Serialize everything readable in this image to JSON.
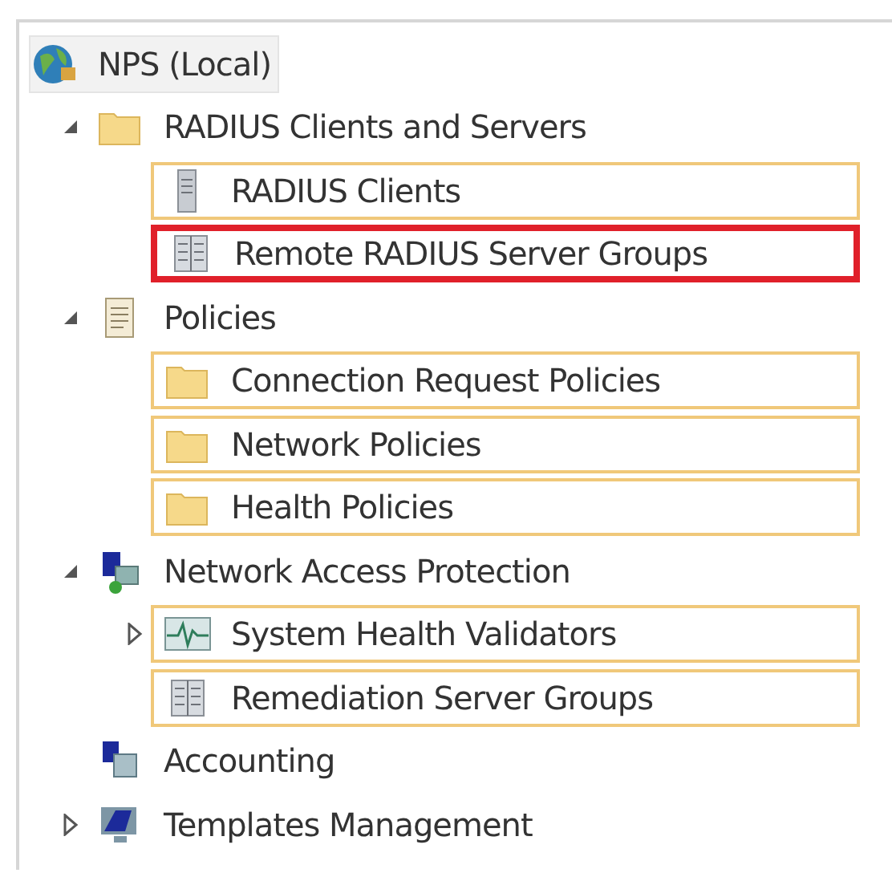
{
  "tree": [
    {
      "label": "NPS (Local)",
      "kind": "globe",
      "children": [
        {
          "label": "RADIUS Clients and Servers",
          "kind": "folder",
          "expanded": true,
          "children": [
            {
              "label": "RADIUS Clients",
              "kind": "server",
              "highlighted": false
            },
            {
              "label": "Remote RADIUS Server Groups",
              "kind": "server-group",
              "highlighted": true
            }
          ]
        },
        {
          "label": "Policies",
          "kind": "document",
          "expanded": true,
          "children": [
            {
              "label": "Connection Request Policies",
              "kind": "folder",
              "highlighted": false
            },
            {
              "label": "Network Policies",
              "kind": "folder",
              "highlighted": false
            },
            {
              "label": "Health Policies",
              "kind": "folder",
              "highlighted": false
            }
          ]
        },
        {
          "label": "Network Access Protection",
          "kind": "network",
          "expanded": true,
          "children": [
            {
              "label": "System Health Validators",
              "kind": "chart",
              "expanded": false,
              "highlighted": false
            },
            {
              "label": "Remediation Server Groups",
              "kind": "server-group",
              "highlighted": false
            }
          ]
        },
        {
          "label": "Accounting",
          "kind": "computers"
        },
        {
          "label": "Templates Management",
          "kind": "monitor",
          "expanded": false
        }
      ]
    }
  ]
}
